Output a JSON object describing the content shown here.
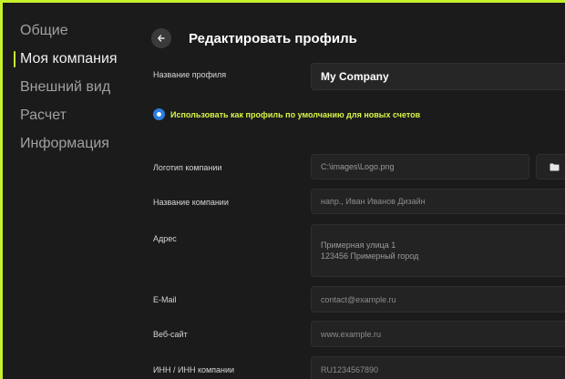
{
  "sidebar": {
    "items": [
      {
        "label": "Общие"
      },
      {
        "label": "Моя компания"
      },
      {
        "label": "Внешний вид"
      },
      {
        "label": "Расчет"
      },
      {
        "label": "Информация"
      }
    ],
    "active_index": 1
  },
  "header": {
    "title": "Редактировать профиль"
  },
  "profile": {
    "name_label": "Название профиля",
    "name_value": "My Company",
    "default_label": "Использовать как профиль по умолчанию для новых счетов",
    "default_checked": true
  },
  "company": {
    "logo_label": "Логотип компании",
    "logo_value": "C:\\images\\Logo.png",
    "name_label": "Название компании",
    "name_placeholder": "напр., Иван Иванов Дизайн",
    "address_label": "Адрес",
    "address_line1": "Примерная улица 1",
    "address_line2": "123456 Примерный город",
    "email_label": "E-Mail",
    "email_placeholder": "contact@example.ru",
    "website_label": "Веб-сайт",
    "website_placeholder": "www.example.ru",
    "tax_label": "ИНН / ИНН компании",
    "tax_placeholder": "RU1234567890"
  },
  "colors": {
    "accent": "#c6f12c",
    "radio": "#2b7fe0",
    "highlight_text": "#d9f545",
    "background": "#1b1b1b"
  },
  "icons": {
    "back": "arrow-left-icon",
    "folder": "folder-icon"
  }
}
